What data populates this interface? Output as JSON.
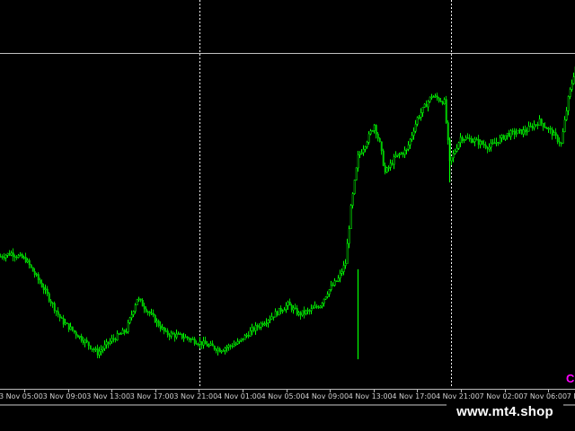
{
  "colors": {
    "background": "#000000",
    "bull_candle": "#00ff00",
    "bear_candle": "#00cc00",
    "separator": "#ffffff",
    "level_line": "#c0c0c0",
    "axis_text": "#cfcfcf",
    "indicator": "#ff00ff"
  },
  "time_axis": {
    "labels": [
      "3 Nov 05:00",
      "3 Nov 09:00",
      "3 Nov 13:00",
      "3 Nov 17:00",
      "3 Nov 21:00",
      "4 Nov 01:00",
      "4 Nov 05:00",
      "4 Nov 09:00",
      "4 Nov 13:00",
      "4 Nov 17:00",
      "4 Nov 21:00",
      "7 Nov 02:00",
      "7 Nov 06:00",
      "7 Nov 1"
    ]
  },
  "indicator_glyph": "C",
  "watermark": "www.mt4.shop",
  "chart_data": {
    "type": "candlestick",
    "title": "",
    "xlabel": "",
    "ylabel": "",
    "grid": false,
    "day_separators": [
      "4 Nov 00:00",
      "7 Nov 00:00"
    ],
    "horizontal_level": "relative 0.93 of visible range",
    "close_profile": [
      [
        0,
        0.37
      ],
      [
        6,
        0.38
      ],
      [
        14,
        0.36
      ],
      [
        24,
        0.27
      ],
      [
        34,
        0.17
      ],
      [
        44,
        0.12
      ],
      [
        54,
        0.07
      ],
      [
        62,
        0.11
      ],
      [
        70,
        0.14
      ],
      [
        76,
        0.24
      ],
      [
        82,
        0.2
      ],
      [
        92,
        0.13
      ],
      [
        102,
        0.12
      ],
      [
        112,
        0.1
      ],
      [
        122,
        0.08
      ],
      [
        132,
        0.1
      ],
      [
        140,
        0.14
      ],
      [
        150,
        0.18
      ],
      [
        160,
        0.22
      ],
      [
        166,
        0.19
      ],
      [
        172,
        0.2
      ],
      [
        178,
        0.22
      ],
      [
        182,
        0.26
      ],
      [
        188,
        0.3
      ],
      [
        192,
        0.35
      ],
      [
        195,
        0.52
      ],
      [
        199,
        0.68
      ],
      [
        203,
        0.72
      ],
      [
        208,
        0.78
      ],
      [
        211,
        0.72
      ],
      [
        214,
        0.63
      ],
      [
        220,
        0.68
      ],
      [
        226,
        0.7
      ],
      [
        232,
        0.8
      ],
      [
        240,
        0.87
      ],
      [
        247,
        0.85
      ],
      [
        250,
        0.66
      ],
      [
        256,
        0.74
      ],
      [
        264,
        0.73
      ],
      [
        272,
        0.71
      ],
      [
        282,
        0.75
      ],
      [
        292,
        0.76
      ],
      [
        300,
        0.79
      ],
      [
        306,
        0.76
      ],
      [
        312,
        0.72
      ],
      [
        316,
        0.86
      ],
      [
        320,
        0.96
      ]
    ]
  }
}
